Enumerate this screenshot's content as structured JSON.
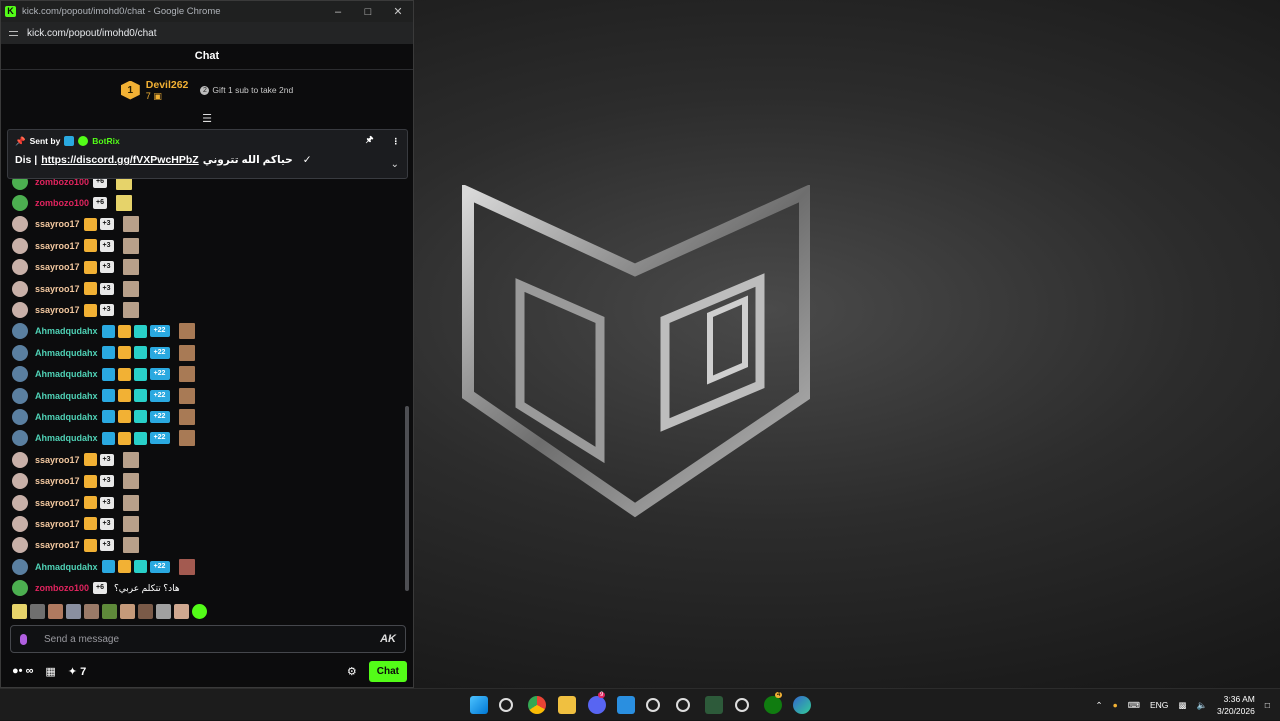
{
  "window": {
    "title": "kick.com/popout/imohd0/chat - Google Chrome",
    "url": "kick.com/popout/imohd0/chat"
  },
  "chat": {
    "header": "Chat",
    "leaderboard": {
      "rank": "1",
      "name": "Devil262",
      "count": "7",
      "hint": "Gift 1 sub to take 2nd"
    },
    "pinned": {
      "sent_by_label": "Sent by",
      "sender": "BotRix",
      "prefix": "Dis |",
      "link": "https://discord.gg/fVXPwcHPbZ",
      "arabic": "حياكم الله تتروني",
      "suffix": "✓"
    },
    "messages": [
      {
        "user": "zombozo100",
        "color": "#e0245e",
        "badges": [
          "sub6"
        ],
        "emote": "#e6d36a"
      },
      {
        "user": "zombozo100",
        "color": "#e0245e",
        "badges": [
          "sub6"
        ],
        "emote": "#e6d36a"
      },
      {
        "user": "ssayroo17",
        "color": "#f4c9a0",
        "badges": [
          "crown",
          "sub3"
        ],
        "emote": "#b8a08a"
      },
      {
        "user": "ssayroo17",
        "color": "#f4c9a0",
        "badges": [
          "crown",
          "sub3"
        ],
        "emote": "#b8a08a"
      },
      {
        "user": "ssayroo17",
        "color": "#f4c9a0",
        "badges": [
          "crown",
          "sub3"
        ],
        "emote": "#b8a08a"
      },
      {
        "user": "ssayroo17",
        "color": "#f4c9a0",
        "badges": [
          "crown",
          "sub3"
        ],
        "emote": "#b8a08a"
      },
      {
        "user": "ssayroo17",
        "color": "#f4c9a0",
        "badges": [
          "crown",
          "sub3"
        ],
        "emote": "#b8a08a"
      },
      {
        "user": "Ahmadqudahx",
        "color": "#4fd1b5",
        "badges": [
          "mod",
          "crown",
          "gift",
          "sub22"
        ],
        "emote": "#a87a55"
      },
      {
        "user": "Ahmadqudahx",
        "color": "#4fd1b5",
        "badges": [
          "mod",
          "crown",
          "gift",
          "sub22"
        ],
        "emote": "#a87a55"
      },
      {
        "user": "Ahmadqudahx",
        "color": "#4fd1b5",
        "badges": [
          "mod",
          "crown",
          "gift",
          "sub22"
        ],
        "emote": "#a87a55"
      },
      {
        "user": "Ahmadqudahx",
        "color": "#4fd1b5",
        "badges": [
          "mod",
          "crown",
          "gift",
          "sub22"
        ],
        "emote": "#a87a55"
      },
      {
        "user": "Ahmadqudahx",
        "color": "#4fd1b5",
        "badges": [
          "mod",
          "crown",
          "gift",
          "sub22"
        ],
        "emote": "#a87a55"
      },
      {
        "user": "Ahmadqudahx",
        "color": "#4fd1b5",
        "badges": [
          "mod",
          "crown",
          "gift",
          "sub22"
        ],
        "emote": "#a87a55"
      },
      {
        "user": "ssayroo17",
        "color": "#f4c9a0",
        "badges": [
          "crown",
          "sub3"
        ],
        "emote": "#b8a08a"
      },
      {
        "user": "ssayroo17",
        "color": "#f4c9a0",
        "badges": [
          "crown",
          "sub3"
        ],
        "emote": "#b8a08a"
      },
      {
        "user": "ssayroo17",
        "color": "#f4c9a0",
        "badges": [
          "crown",
          "sub3"
        ],
        "emote": "#b8a08a"
      },
      {
        "user": "ssayroo17",
        "color": "#f4c9a0",
        "badges": [
          "crown",
          "sub3"
        ],
        "emote": "#b8a08a"
      },
      {
        "user": "ssayroo17",
        "color": "#f4c9a0",
        "badges": [
          "crown",
          "sub3"
        ],
        "emote": "#b8a08a"
      },
      {
        "user": "Ahmadqudahx",
        "color": "#4fd1b5",
        "badges": [
          "mod",
          "crown",
          "gift",
          "sub22"
        ],
        "emote": "#a35a50"
      },
      {
        "user": "zombozo100",
        "color": "#e0245e",
        "badges": [
          "sub6"
        ],
        "text": "هاد؟ تتكلم عربي؟"
      }
    ],
    "badge_labels": {
      "sub3": "+3",
      "sub6": "+6",
      "sub22": "+22"
    },
    "input": {
      "placeholder": "Send a message"
    },
    "footer": {
      "points": "∞",
      "stars": "7",
      "chat_button": "Chat"
    }
  },
  "taskbar": {
    "lang": "ENG",
    "time": "3:36 AM",
    "date": "3/20/2026",
    "discord_badge": "9",
    "xbox_badge": "4"
  },
  "colors": {
    "kick_green": "#53fc18",
    "gold": "#f2b134"
  }
}
